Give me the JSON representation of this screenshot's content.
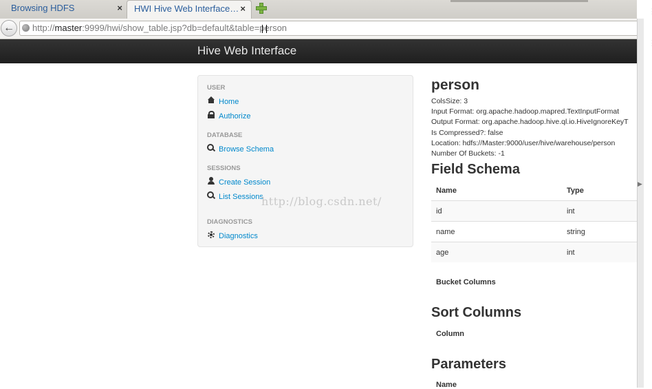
{
  "browser": {
    "tabs": [
      {
        "label": "Browsing HDFS",
        "close": "×"
      },
      {
        "label": "HWI Hive Web Interface…",
        "close": "×"
      }
    ],
    "url_prefix": "http://",
    "url_host": "master",
    "url_rest": ":9999/hwi/show_table.jsp?db=default&table=person"
  },
  "page": {
    "brand": "Hive Web Interface",
    "sidebar": {
      "user_header": "USER",
      "home": "Home",
      "authorize": "Authorize",
      "database_header": "DATABASE",
      "browse_schema": "Browse Schema",
      "sessions_header": "SESSIONS",
      "create_session": "Create Session",
      "list_sessions": "List Sessions",
      "diagnostics_header": "DIAGNOSTICS",
      "diagnostics": "Diagnostics"
    },
    "watermark": "http://blog.csdn.net/",
    "table": {
      "name": "person",
      "props": [
        "ColsSize: 3",
        "Input Format: org.apache.hadoop.mapred.TextInputFormat",
        "Output Format: org.apache.hadoop.hive.ql.io.HiveIgnoreKeyT",
        "Is Compressed?: false",
        "Location: hdfs://Master:9000/user/hive/warehouse/person",
        "Number Of Buckets: -1"
      ]
    },
    "field_schema": {
      "title": "Field Schema",
      "col_name": "Name",
      "col_type": "Type",
      "rows": [
        {
          "name": "id",
          "type": "int"
        },
        {
          "name": "name",
          "type": "string"
        },
        {
          "name": "age",
          "type": "int"
        }
      ]
    },
    "bucket_columns": "Bucket Columns",
    "sort_columns": {
      "title": "Sort Columns",
      "col": "Column"
    },
    "parameters": {
      "title": "Parameters",
      "col": "Name"
    }
  }
}
